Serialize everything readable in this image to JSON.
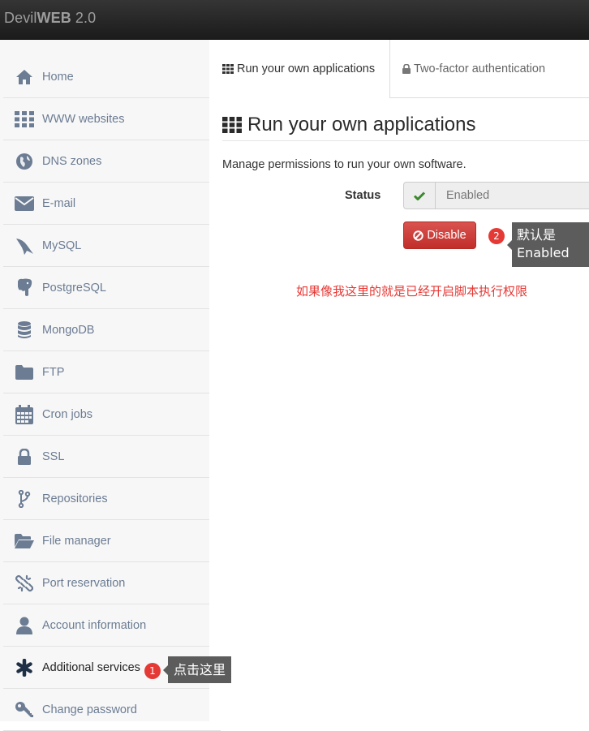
{
  "app": {
    "brand_light": "Devil",
    "brand_bold": "WEB",
    "brand_version": " 2.0"
  },
  "sidebar": {
    "items": [
      {
        "label": "Home",
        "icon": "home-icon"
      },
      {
        "label": "WWW websites",
        "icon": "grid-icon"
      },
      {
        "label": "DNS zones",
        "icon": "globe-icon"
      },
      {
        "label": "E-mail",
        "icon": "envelope-icon"
      },
      {
        "label": "MySQL",
        "icon": "dolphin-icon"
      },
      {
        "label": "PostgreSQL",
        "icon": "elephant-icon"
      },
      {
        "label": "MongoDB",
        "icon": "database-icon"
      },
      {
        "label": "FTP",
        "icon": "folder-icon"
      },
      {
        "label": "Cron jobs",
        "icon": "calendar-icon"
      },
      {
        "label": "SSL",
        "icon": "lock-icon"
      },
      {
        "label": "Repositories",
        "icon": "branch-icon"
      },
      {
        "label": "File manager",
        "icon": "folder-open-icon"
      },
      {
        "label": "Port reservation",
        "icon": "link-broken-icon"
      },
      {
        "label": "Account information",
        "icon": "user-icon"
      },
      {
        "label": "Additional services",
        "icon": "asterisk-icon"
      },
      {
        "label": "Change password",
        "icon": "key-icon"
      }
    ]
  },
  "annotations": {
    "badge1": "1",
    "tip1": "点击这里",
    "badge2": "2",
    "tip2_line1": "默认是",
    "tip2_line2": "Enabled",
    "note": "如果像我这里的就是已经开启脚本执行权限"
  },
  "tabs": [
    {
      "label": "Run your own applications",
      "icon": "grid-icon",
      "active": true
    },
    {
      "label": "Two-factor authentication",
      "icon": "lock-icon",
      "active": false
    }
  ],
  "main": {
    "title": "Run your own applications",
    "description": "Manage permissions to run your own software.",
    "status_label": "Status",
    "status_value": "Enabled",
    "disable_button": "Disable"
  },
  "colors": {
    "sidebar_icon": "#6b7c93",
    "accent_red": "#d9534f",
    "annotation_red": "#e53935",
    "check_green": "#3c8a2e"
  }
}
